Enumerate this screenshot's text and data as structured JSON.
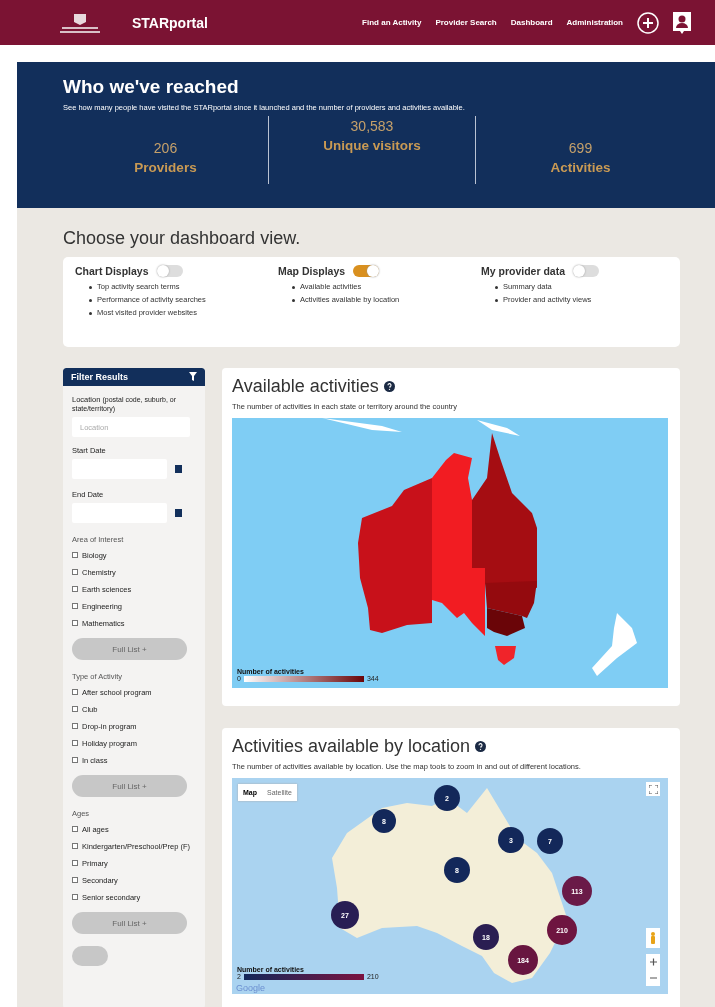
{
  "header": {
    "logo_text": "STARportal",
    "nav": [
      {
        "label": "Find an Activity"
      },
      {
        "label": "Provider Search"
      },
      {
        "label": "Dashboard"
      },
      {
        "label": "Administration"
      }
    ]
  },
  "reach": {
    "title": "Who we've reached",
    "subtitle": "See how many people have visited the STARportal since it launched and the number of providers and activities available.",
    "stats": [
      {
        "value": "206",
        "label": "Providers"
      },
      {
        "value": "30,583",
        "label": "Unique visitors"
      },
      {
        "value": "699",
        "label": "Activities"
      }
    ]
  },
  "dashboard_view": {
    "title": "Choose your dashboard view.",
    "options": [
      {
        "label": "Chart Displays",
        "on": false,
        "items": [
          "Top activity search terms",
          "Performance of activity searches",
          "Most visited provider websites"
        ]
      },
      {
        "label": "Map Displays",
        "on": true,
        "items": [
          "Available activities",
          "Activities available by location"
        ]
      },
      {
        "label": "My provider data",
        "on": false,
        "items": [
          "Summary data",
          "Provider and activity views"
        ]
      }
    ]
  },
  "filter": {
    "title": "Filter Results",
    "location_label": "Location",
    "location_hint": "(postal code, suburb, or state/territory)",
    "location_placeholder": "Location",
    "start_label": "Start Date",
    "end_label": "End Date",
    "groups": [
      {
        "title": "Area of Interest",
        "button": "Full List +",
        "options": [
          {
            "label": "Biology",
            "checked": false
          },
          {
            "label": "Chemistry",
            "checked": false
          },
          {
            "label": "Earth sciences",
            "checked": false
          },
          {
            "label": "Engineering",
            "checked": false
          },
          {
            "label": "Mathematics",
            "checked": false
          }
        ]
      },
      {
        "title": "Type of Activity",
        "button": "Full List +",
        "options": [
          {
            "label": "After school program",
            "checked": false
          },
          {
            "label": "Club",
            "checked": false
          },
          {
            "label": "Drop-in program",
            "checked": false
          },
          {
            "label": "Holiday program",
            "checked": false
          },
          {
            "label": "In class",
            "checked": false
          }
        ]
      },
      {
        "title": "Ages",
        "button": "Full List +",
        "options": [
          {
            "label": "All ages",
            "checked": false
          },
          {
            "label": "Kindergarten/Preschool/Prep (F)",
            "checked": false
          },
          {
            "label": "Primary",
            "checked": false
          },
          {
            "label": "Secondary",
            "checked": false
          },
          {
            "label": "Senior secondary",
            "checked": false
          }
        ]
      }
    ]
  },
  "available_activities": {
    "title": "Available activities",
    "description": "The number of activities in each state or territory around the country",
    "legend_title": "Number of activities",
    "legend_min": "0",
    "legend_max": "344",
    "regions": [
      {
        "kind": "wa",
        "color": "#c8111a"
      },
      {
        "kind": "nt",
        "color": "#f21c22"
      },
      {
        "kind": "sa",
        "color": "#f21c22"
      },
      {
        "kind": "qld",
        "color": "#a50d12"
      },
      {
        "kind": "nsw",
        "color": "#940a0e"
      },
      {
        "kind": "vic",
        "color": "#6a0508"
      },
      {
        "kind": "tas",
        "color": "#f0242a"
      }
    ]
  },
  "activities_by_location": {
    "title": "Activities available by location",
    "description": "The number of activities available by location. Use the map tools to zoom in and out of different locations.",
    "map_types": [
      {
        "label": "Map",
        "selected": true
      },
      {
        "label": "Satellite",
        "selected": false
      }
    ],
    "legend_title": "Number of activities",
    "legend_min": "2",
    "legend_max": "210",
    "attribution": "Google",
    "markers": [
      {
        "label": "2",
        "color": "#13285a"
      },
      {
        "label": "8",
        "color": "#13285a"
      },
      {
        "label": "3",
        "color": "#13285a"
      },
      {
        "label": "7",
        "color": "#13285a"
      },
      {
        "label": "8",
        "color": "#13285a"
      },
      {
        "label": "27",
        "color": "#281e54"
      },
      {
        "label": "18",
        "color": "#2a1e52"
      },
      {
        "label": "113",
        "color": "#6a1a48"
      },
      {
        "label": "210",
        "color": "#6e1540"
      },
      {
        "label": "184",
        "color": "#681640"
      }
    ]
  }
}
